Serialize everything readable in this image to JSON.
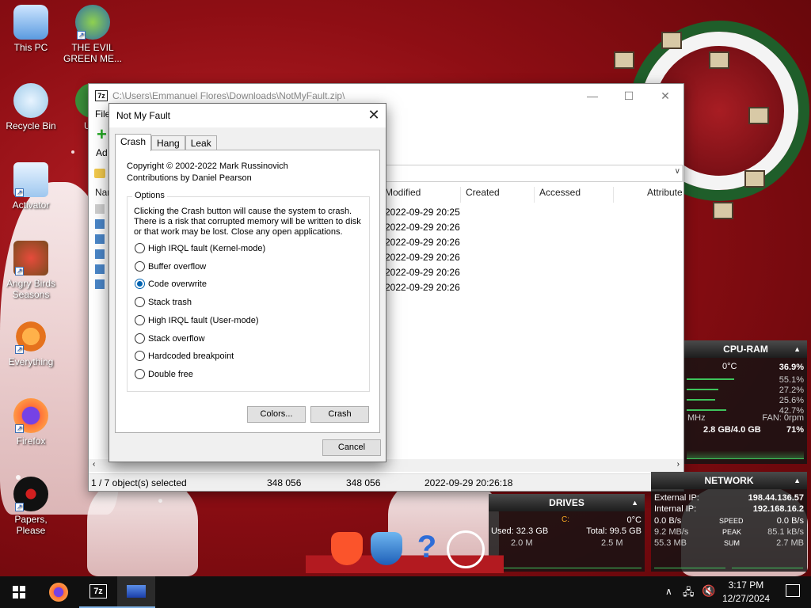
{
  "desktop": {
    "icons": [
      {
        "label": "This PC"
      },
      {
        "label": "THE EVIL GREEN ME..."
      },
      {
        "label": "Recycle Bin"
      },
      {
        "label": "Und"
      },
      {
        "label": "Activator"
      },
      {
        "label": "Angry Birds Seasons"
      },
      {
        "label": "Everything"
      },
      {
        "label": "Firefox"
      },
      {
        "label": "Papers, Please"
      }
    ]
  },
  "zip_window": {
    "title": "C:\\Users\\Emmanuel Flores\\Downloads\\NotMyFault.zip\\",
    "menu_file": "File",
    "toolbar_add": "Ad",
    "columns": {
      "name": "Nar",
      "modified": "Modified",
      "created": "Created",
      "accessed": "Accessed",
      "attributes": "Attribute"
    },
    "rows": [
      {
        "modified": "2022-09-29 20:25"
      },
      {
        "modified": "2022-09-29 20:26"
      },
      {
        "modified": "2022-09-29 20:26"
      },
      {
        "modified": "2022-09-29 20:26"
      },
      {
        "modified": "2022-09-29 20:26"
      },
      {
        "modified": "2022-09-29 20:26"
      }
    ],
    "status": {
      "selected": "1 / 7 object(s) selected",
      "size": "348 056",
      "packed": "348 056",
      "date": "2022-09-29 20:26:18"
    }
  },
  "dialog": {
    "title": "Not My Fault",
    "tabs": [
      "Crash",
      "Hang",
      "Leak"
    ],
    "copyright_line1": "Copyright © 2002-2022 Mark Russinovich",
    "copyright_line2": "Contributions by Daniel Pearson",
    "group_label": "Options",
    "description": "Clicking the Crash button will cause the system to crash. There is a risk that corrupted memory will be written to disk or that work may be lost. Close any open applications.",
    "options": [
      {
        "label": "High IRQL fault (Kernel-mode)",
        "checked": false
      },
      {
        "label": "Buffer overflow",
        "checked": false
      },
      {
        "label": "Code overwrite",
        "checked": true
      },
      {
        "label": "Stack trash",
        "checked": false
      },
      {
        "label": "High IRQL fault (User-mode)",
        "checked": false
      },
      {
        "label": "Stack overflow",
        "checked": false
      },
      {
        "label": "Hardcoded breakpoint",
        "checked": false
      },
      {
        "label": "Double free",
        "checked": false
      }
    ],
    "colors_button": "Colors...",
    "crash_button": "Crash",
    "cancel_button": "Cancel"
  },
  "cpu_widget": {
    "title": "CPU-RAM",
    "temp": "0°C",
    "total": "36.9%",
    "cores": [
      "55.1%",
      "27.2%",
      "25.6%",
      "42.7%"
    ],
    "mhz": "MHz",
    "fan": "FAN: 0rpm",
    "ram": "2.8 GB/4.0 GB",
    "ram_pct": "71%"
  },
  "drives_widget": {
    "title": "DRIVES",
    "drive": "C:",
    "temp": "0°C",
    "used": "Used: 32.3 GB",
    "total": "Total: 99.5 GB",
    "read": "2.0 M",
    "write": "2.5 M"
  },
  "network_widget": {
    "title": "NETWORK",
    "external": "External IP:",
    "external_ip": "198.44.136.57",
    "internal": "Internal IP:",
    "internal_ip": "192.168.16.2",
    "down": "0.0 B/s",
    "speed": "SPEED",
    "up": "0.0 B/s",
    "down2": "9.2 MB/s",
    "peak": "PEAK",
    "up2": "85.1 kB/s",
    "down3": "55.3 MB",
    "sum": "SUM",
    "up3": "2.7 MB"
  },
  "taskbar": {
    "time": "3:17 PM",
    "date": "12/27/2024",
    "zip_label": "7z"
  },
  "colors": {
    "accent": "#0063b1",
    "widget_green": "#3ec45c"
  }
}
